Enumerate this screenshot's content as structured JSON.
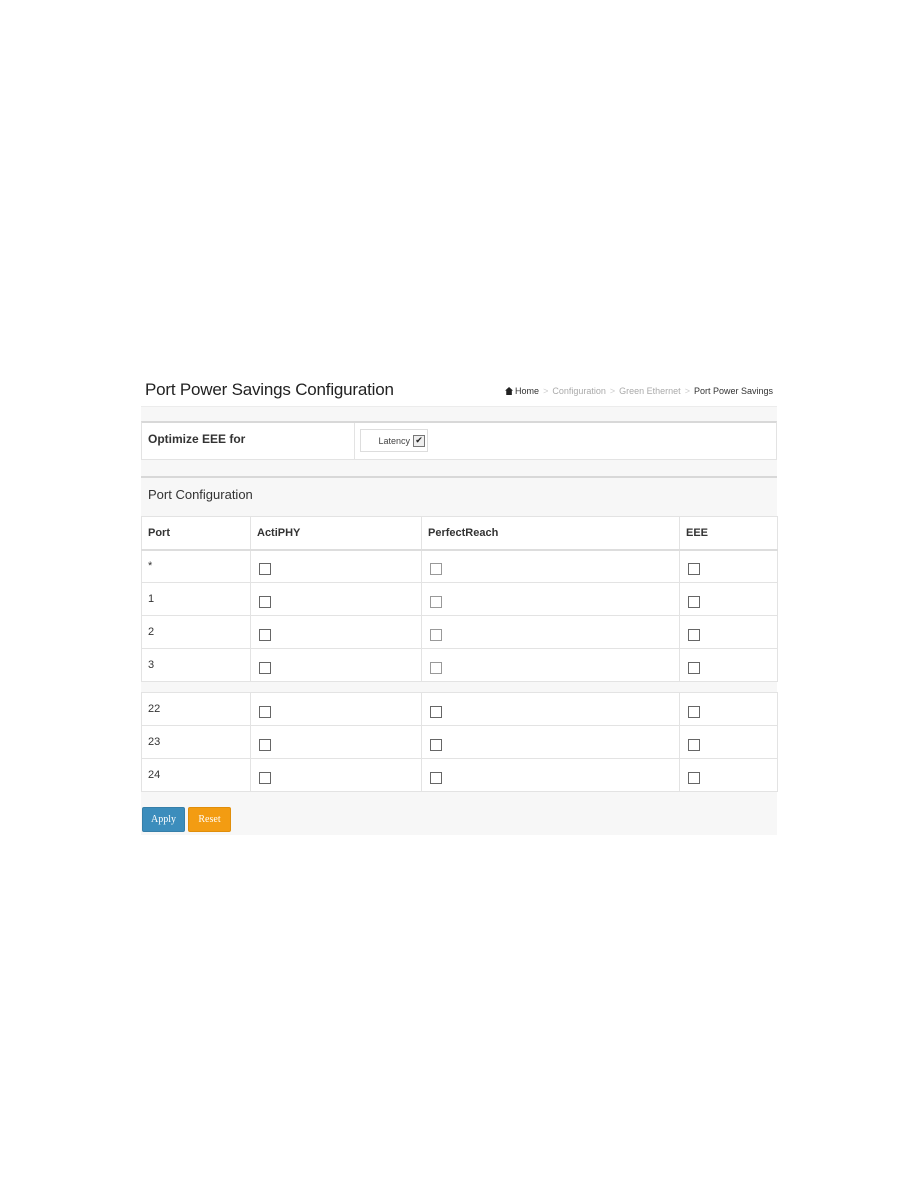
{
  "header": {
    "title": "Port Power Savings Configuration",
    "breadcrumb": {
      "home_icon": "home-icon",
      "items": [
        "Home",
        "Configuration",
        "Green Ethernet",
        "Port Power Savings"
      ],
      "separator": ">"
    }
  },
  "optimize": {
    "label": "Optimize EEE for",
    "selected": "Latency",
    "arrow_icon": "chevron-down-icon",
    "arrow_glyph": "✔"
  },
  "port_config": {
    "title": "Port Configuration",
    "columns": [
      "Port",
      "ActiPHY",
      "PerfectReach",
      "EEE"
    ],
    "rows_top": [
      {
        "port": "*",
        "actiphy": false,
        "perfectreach": false,
        "eee": false
      },
      {
        "port": "1",
        "actiphy": false,
        "perfectreach": false,
        "eee": false
      },
      {
        "port": "2",
        "actiphy": false,
        "perfectreach": false,
        "eee": false
      },
      {
        "port": "3",
        "actiphy": false,
        "perfectreach": false,
        "eee": false
      }
    ],
    "rows_bottom": [
      {
        "port": "22",
        "actiphy": false,
        "perfectreach": false,
        "eee": false
      },
      {
        "port": "23",
        "actiphy": false,
        "perfectreach": false,
        "eee": false
      },
      {
        "port": "24",
        "actiphy": false,
        "perfectreach": false,
        "eee": false
      }
    ]
  },
  "buttons": {
    "apply_label": "Apply",
    "reset_label": "Reset",
    "apply_color": "#3c8dbc",
    "reset_color": "#f39c12"
  }
}
